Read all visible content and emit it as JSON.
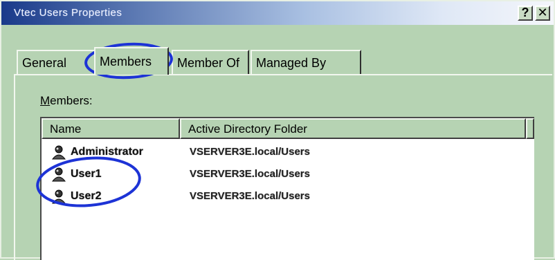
{
  "window": {
    "title": "Vtec Users Properties",
    "help_label": "?",
    "close_label": "✕"
  },
  "tabs": [
    {
      "label": "General"
    },
    {
      "label": "Members",
      "selected": true
    },
    {
      "label": "Member Of"
    },
    {
      "label": "Managed By"
    }
  ],
  "members_section": {
    "label_first": "M",
    "label_rest": "embers:"
  },
  "listview": {
    "columns": [
      "Name",
      "Active Directory Folder"
    ],
    "rows": [
      {
        "name": "Administrator",
        "folder": "VSERVER3E.local/Users",
        "icon": "user-icon"
      },
      {
        "name": "User1",
        "folder": "VSERVER3E.local/Users",
        "icon": "user-icon"
      },
      {
        "name": "User2",
        "folder": "VSERVER3E.local/Users",
        "icon": "user-icon"
      }
    ]
  },
  "colors": {
    "dialog_bg": "#b6d3b3",
    "title_gradient_start": "#1a3a8a",
    "annotation": "#1d33d6"
  }
}
